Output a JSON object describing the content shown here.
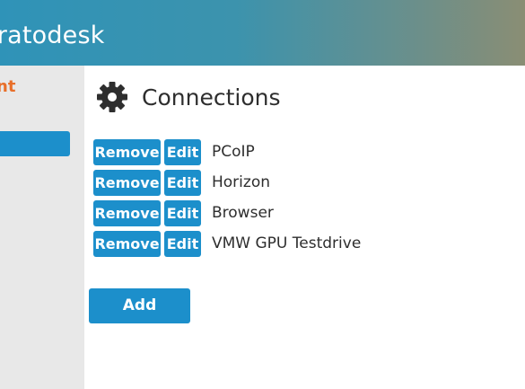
{
  "header": {
    "brand": "tratodesk"
  },
  "sidebar": {
    "user_label": "nt"
  },
  "page": {
    "title": "Connections",
    "icon": "gear-icon"
  },
  "buttons": {
    "remove_label": "Remove",
    "edit_label": "Edit",
    "add_label": "Add"
  },
  "connections": [
    {
      "name": "PCoIP"
    },
    {
      "name": "Horizon"
    },
    {
      "name": "Browser"
    },
    {
      "name": "VMW GPU Testdrive"
    }
  ],
  "colors": {
    "accent": "#1c8fcb",
    "user_label": "#e86f2a",
    "sidebar_bg": "#e8e8e8"
  }
}
